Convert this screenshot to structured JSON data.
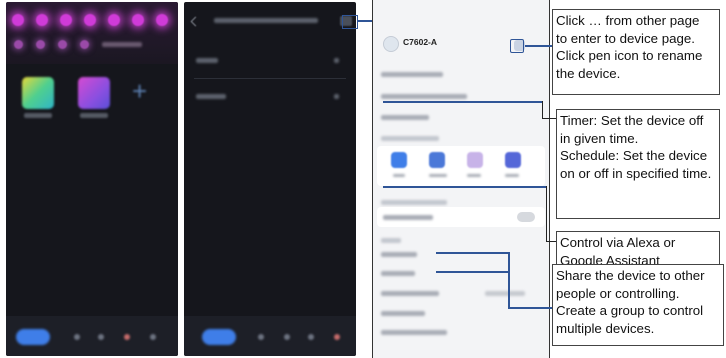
{
  "device": {
    "name": "C7602-A"
  },
  "notes": {
    "rename": [
      "Click … from other page",
      "to enter to device page.",
      "Click pen icon to rename",
      "the device."
    ],
    "timer": [
      "Timer: Set the device off",
      "in given time.",
      "Schedule: Set the device",
      "on or off in specified time."
    ],
    "alexa": [
      "Control via Alexa or",
      "Google Assistant"
    ],
    "share": [
      "Share the device to other",
      "people or controlling.",
      "Create a group to control",
      "multiple devices."
    ]
  },
  "colors": {
    "accent_line": "#2f5597",
    "led_glow": "#d03bd8",
    "nav_active": "#3f7ee8"
  }
}
